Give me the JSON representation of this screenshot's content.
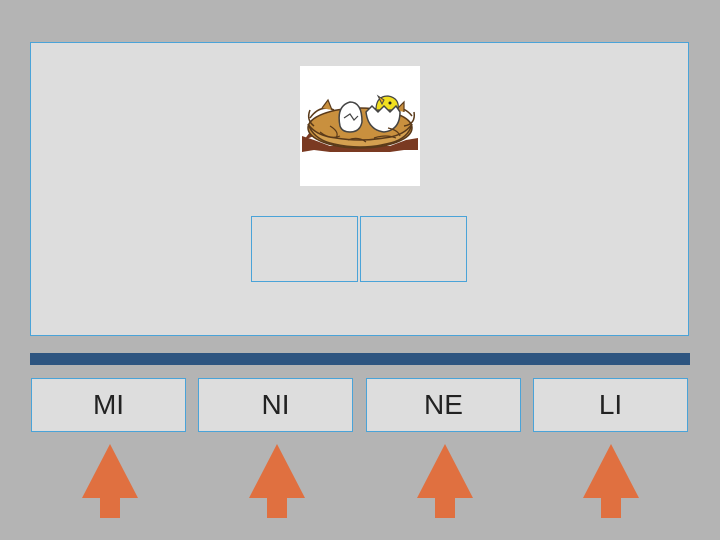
{
  "picture": {
    "icon": "nest-with-hatching-chick-icon"
  },
  "answer_slots": [
    "",
    ""
  ],
  "syllables": [
    {
      "label": "MI"
    },
    {
      "label": "NI"
    },
    {
      "label": "NE"
    },
    {
      "label": "LI"
    }
  ],
  "colors": {
    "background": "#b4b4b4",
    "panel": "#dddddd",
    "border": "#4aa3d8",
    "divider": "#2e5580",
    "arrow": "#e07040"
  }
}
